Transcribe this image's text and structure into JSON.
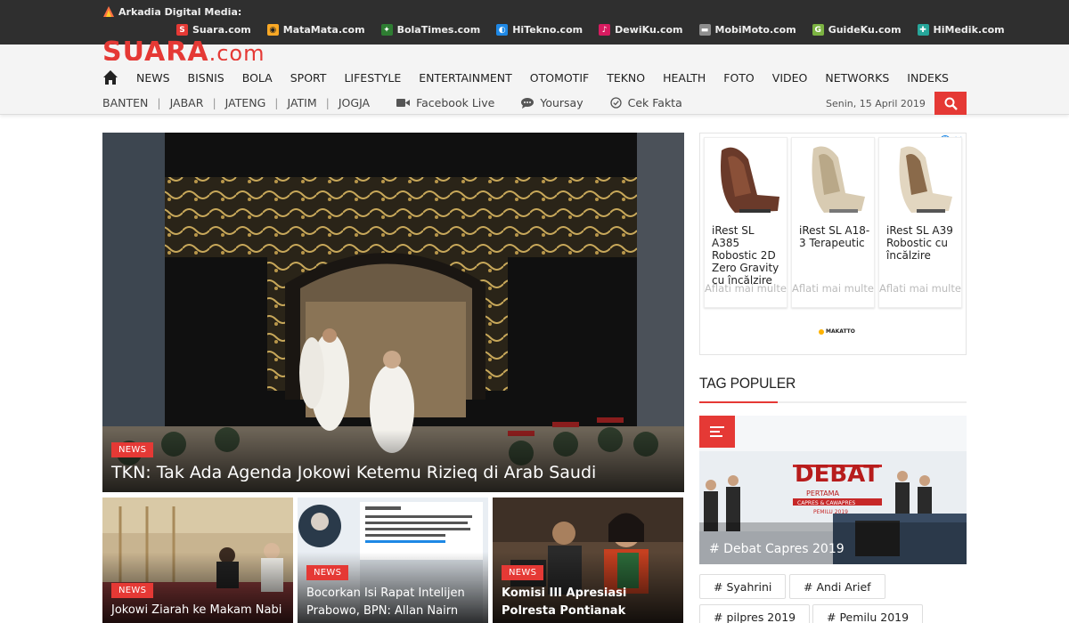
{
  "network": {
    "brand": "Arkadia Digital Media:",
    "sites": [
      {
        "name": "Suara.com",
        "icon": "suara-icon",
        "color": "#e53935",
        "glyph": "S"
      },
      {
        "name": "MataMata.com",
        "icon": "matamata-icon",
        "color": "#f9a825",
        "glyph": "◉"
      },
      {
        "name": "BolaTimes.com",
        "icon": "bolatimes-icon",
        "color": "#2e7d32",
        "glyph": "✦"
      },
      {
        "name": "HiTekno.com",
        "icon": "hitekno-icon",
        "color": "#1e88e5",
        "glyph": "◐"
      },
      {
        "name": "DewiKu.com",
        "icon": "dewiku-icon",
        "color": "#d81b60",
        "glyph": "♪"
      },
      {
        "name": "MobiMoto.com",
        "icon": "mobimoto-icon",
        "color": "#8d8d8d",
        "glyph": "▬"
      },
      {
        "name": "GuideKu.com",
        "icon": "guideku-icon",
        "color": "#7cb342",
        "glyph": "G"
      },
      {
        "name": "HiMedik.com",
        "icon": "himedik-icon",
        "color": "#26a69a",
        "glyph": "✚"
      }
    ]
  },
  "header": {
    "logo_main": "SUARA",
    "logo_suffix": ".com",
    "nav": [
      "NEWS",
      "BISNIS",
      "BOLA",
      "SPORT",
      "LIFESTYLE",
      "ENTERTAINMENT",
      "OTOMOTIF",
      "TEKNO",
      "HEALTH",
      "FOTO",
      "VIDEO",
      "NETWORKS",
      "INDEKS"
    ],
    "regions": [
      "BANTEN",
      "JABAR",
      "JATENG",
      "JATIM",
      "JOGJA"
    ],
    "extras": [
      {
        "label": "Facebook Live",
        "icon": "video-camera-icon"
      },
      {
        "label": "Yoursay",
        "icon": "chat-bubble-icon"
      },
      {
        "label": "Cek Fakta",
        "icon": "check-circle-icon"
      }
    ],
    "date": "Senin, 15 April 2019"
  },
  "hero": {
    "badge": "NEWS",
    "title": "TKN: Tak Ada Agenda Jokowi Ketemu Rizieq di Arab Saudi"
  },
  "cards": [
    {
      "badge": "NEWS",
      "title": "Jokowi Ziarah ke Makam Nabi"
    },
    {
      "badge": "NEWS",
      "title": "Bocorkan Isi Rapat Intelijen Prabowo, BPN: Allan Nairn"
    },
    {
      "badge": "NEWS",
      "title": "Komisi III Apresiasi Polresta Pontianak Tangani Kasus"
    }
  ],
  "ad": {
    "products": [
      {
        "name": "iRest SL A385 Robostic 2D Zero Gravity cu încălzire",
        "more": "Aflati mai multe"
      },
      {
        "name": "iRest SL A18-3 Terapeutic",
        "more": "Aflati mai multe"
      },
      {
        "name": "iRest SL A39 Robostic cu încălzire",
        "more": "Aflati mai multe"
      }
    ],
    "logo": "MAKATTO"
  },
  "tag_populer": {
    "title": "TAG POPULER",
    "feature_title": "# Debat Capres 2019",
    "tags": [
      "# Syahrini",
      "# Andi Arief",
      "# pilpres 2019",
      "# Pemilu 2019"
    ]
  }
}
